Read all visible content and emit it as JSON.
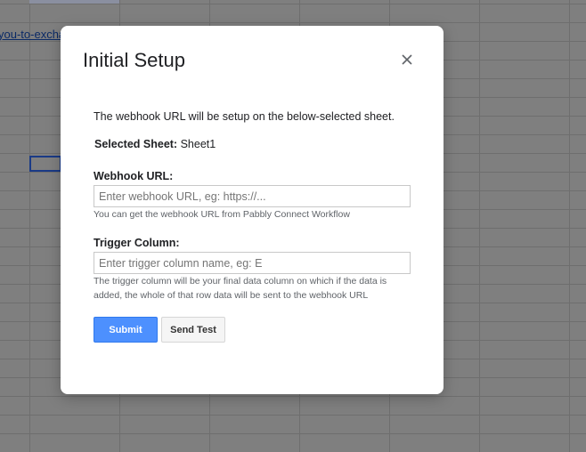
{
  "background": {
    "link_text": "you-to-excha"
  },
  "dialog": {
    "title": "Initial Setup",
    "intro": "The webhook URL will be setup on the below-selected sheet.",
    "selected_sheet_label": "Selected Sheet:",
    "selected_sheet_value": "Sheet1",
    "webhook": {
      "label": "Webhook URL:",
      "value": "",
      "placeholder": "Enter webhook URL, eg: https://...",
      "help": "You can get the webhook URL from Pabbly Connect Workflow"
    },
    "trigger": {
      "label": "Trigger Column:",
      "value": "",
      "placeholder": "Enter trigger column name, eg: E",
      "help": "The trigger column will be your final data column on which if the data is added, the whole of that row data will be sent to the webhook URL"
    },
    "buttons": {
      "submit": "Submit",
      "send_test": "Send Test"
    }
  },
  "colors": {
    "accent": "#4d90fe",
    "overlay": "#7f7f7f"
  },
  "icons": {
    "close": "close-icon"
  }
}
